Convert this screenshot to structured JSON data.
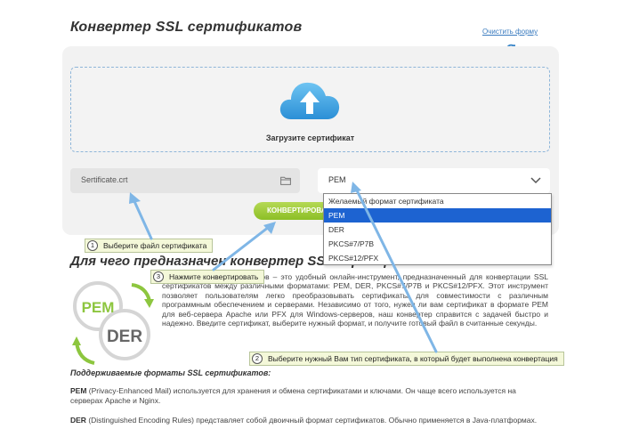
{
  "header": {
    "title": "Конвертер SSL сертификатов",
    "clear_link": "Очистить форму"
  },
  "upload": {
    "label": "Загрузите сертификат"
  },
  "file_field": {
    "value": "Sertificate.crt"
  },
  "format_select": {
    "value": "PEM",
    "options": [
      {
        "label": "Желаемый формат сертификата",
        "selected": false
      },
      {
        "label": "PEM",
        "selected": true
      },
      {
        "label": "DER",
        "selected": false
      },
      {
        "label": "PKCS#7/P7B",
        "selected": false
      },
      {
        "label": "PKCS#12/PFX",
        "selected": false
      }
    ]
  },
  "convert_button": {
    "label": "КОНВЕРТИРОВАТЬ"
  },
  "article": {
    "title": "Для чего предназначен конвертер SSL сертификатов?",
    "logo_labels": [
      "PEM",
      "DER"
    ],
    "intro": "Конвертер SSL сертификатов – это удобный онлайн-инструмент, предназначенный для конвертации SSL сертификатов между различными форматами: PEM, DER, PKCS#7/P7B и PKCS#12/PFX. Этот инструмент позволяет пользователям легко преобразовывать сертификаты для совместимости с различным программным обеспечением и серверами. Независимо от того, нужен ли вам сертификат в формате PEM для веб-сервера Apache или PFX для Windows-серверов, наш конвертер справится с задачей быстро и надежно. Введите сертификат, выберите нужный формат, и получите готовый файл в считанные секунды.",
    "formats_heading": "Поддерживаемые форматы SSL сертификатов:",
    "formats": [
      {
        "name": "PEM",
        "text": " (Privacy-Enhanced Mail) используется для хранения и обмена сертификатами и ключами. Он чаще всего используется на серверах Apache и Nginx."
      },
      {
        "name": "DER",
        "text": " (Distinguished Encoding Rules) представляет собой двоичный формат сертификатов. Обычно применяется в Java-платформах."
      }
    ]
  },
  "callouts": [
    {
      "num": "1",
      "text": "Выберите файл сертификата"
    },
    {
      "num": "2",
      "text": "Выберите нужный Вам тип сертификата, в который будет выполнена конвертация"
    },
    {
      "num": "3",
      "text": "Нажмите конвертировать"
    }
  ],
  "colors": {
    "accent_blue": "#1d63d1",
    "button_green": "#8cbf26",
    "callout_arrow": "#7fb6e6"
  }
}
